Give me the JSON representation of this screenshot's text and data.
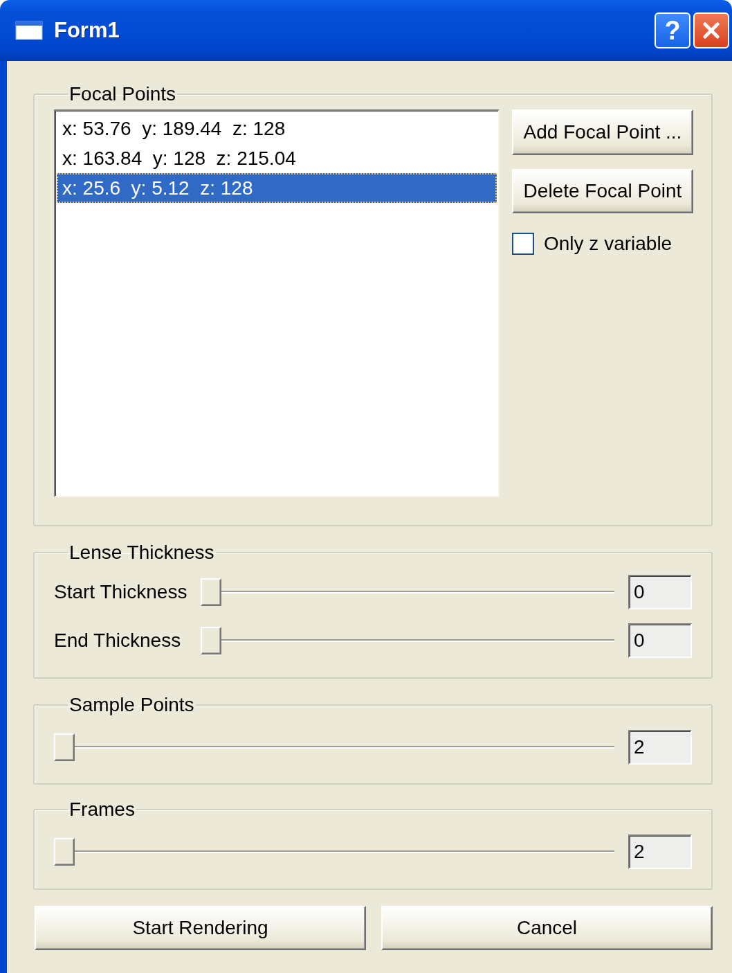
{
  "window": {
    "title": "Form1",
    "help_button": "?"
  },
  "focal_points": {
    "label": "Focal Points",
    "items": [
      {
        "text": "x: 53.76  y: 189.44  z: 128",
        "selected": false
      },
      {
        "text": "x: 163.84  y: 128  z: 215.04",
        "selected": false
      },
      {
        "text": "x: 25.6  y: 5.12  z: 128",
        "selected": true
      }
    ],
    "add_button": "Add Focal Point ...",
    "delete_button": "Delete Focal Point",
    "only_z": {
      "label": "Only z variable",
      "checked": false
    }
  },
  "lense_thickness": {
    "label": "Lense Thickness",
    "sliders": [
      {
        "label": "Start Thickness",
        "level": 0,
        "value": "0"
      },
      {
        "label": "End Thickness",
        "level": 0,
        "value": "0"
      }
    ]
  },
  "sample_points": {
    "label": "Sample Points",
    "slider": {
      "level": 0,
      "value": "2"
    }
  },
  "frames": {
    "label": "Frames",
    "slider": {
      "level": 0,
      "value": "2"
    }
  },
  "buttons": [
    "Start Rendering",
    "Cancel"
  ]
}
